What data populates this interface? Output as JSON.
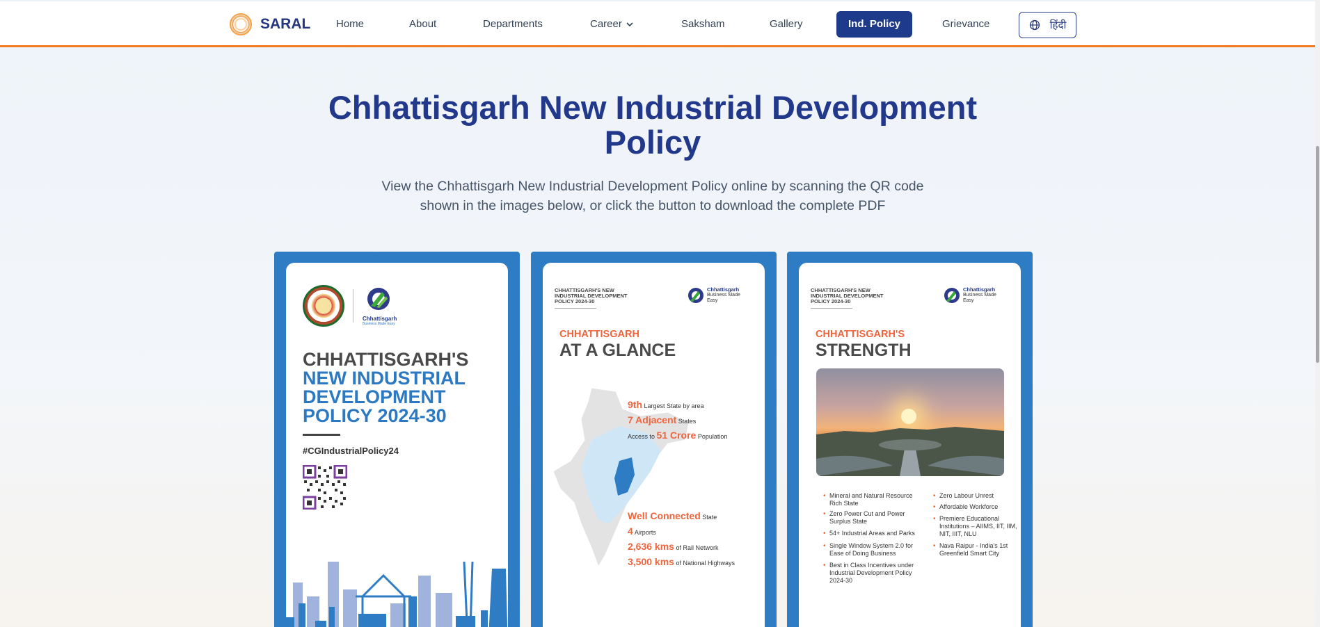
{
  "brand": {
    "name": "SARAL"
  },
  "nav": {
    "home": "Home",
    "about": "About",
    "departments": "Departments",
    "career": "Career",
    "saksham": "Saksham",
    "gallery": "Gallery",
    "ind_policy": "Ind. Policy",
    "grievance": "Grievance",
    "language": "हिंदी"
  },
  "hero": {
    "title": "Chhattisgarh New Industrial Development Policy",
    "subtitle": "View the Chhattisgarh New Industrial Development Policy online by scanning the QR code shown in the images below, or click the button to download the complete PDF"
  },
  "cards": {
    "c1": {
      "logo_text": "Chhattisgarh",
      "logo_sub": "Business Made Easy",
      "line1": "CHHATTISGARH'S",
      "line2": "NEW INDUSTRIAL",
      "line3": "DEVELOPMENT",
      "line4": "POLICY 2024-30",
      "hashtag": "#CGIndustrialPolicy24"
    },
    "header": {
      "policy_label": "CHHATTISGARH'S NEW INDUSTRIAL DEVELOPMENT POLICY 2024-30",
      "logo_text": "Chhattisgarh",
      "logo_sub": "Business Made Easy"
    },
    "c2": {
      "kicker": "CHHATTISGARH",
      "big": "AT A GLANCE",
      "s1_hl": "9th",
      "s1": "Largest State by area",
      "s2_hl": "7 Adjacent",
      "s2": "States",
      "s3_pre": "Access to",
      "s3_hl": "51 Crore",
      "s3": "Population",
      "s4_hl": "Well Connected",
      "s4": "State",
      "s5_hl": "4",
      "s5": "Airports",
      "s6_hl": "2,636 kms",
      "s6": "of Rail Network",
      "s7_hl": "3,500 kms",
      "s7": "of National Highways"
    },
    "c3": {
      "kicker": "CHHATTISGARH'S",
      "big": "STRENGTH",
      "left": [
        "Mineral and Natural Resource Rich State",
        "Zero Power Cut and Power Surplus State",
        "54+ Industrial Areas and Parks",
        "Single Window System 2.0 for Ease of Doing Business",
        "Best in Class Incentives under Industrial Development Policy 2024-30"
      ],
      "right": [
        "Zero Labour Unrest",
        "Affordable Workforce",
        "Premiere Educational Institutions – AIIMS, IIT, IIM, NIT, IIIT, NLU",
        "Nava Raipur - India's 1st Greenfield Smart City"
      ]
    }
  },
  "colors": {
    "accent": "#1e3a8a",
    "orange": "#f07b22",
    "card_blue": "#2e7cc3"
  }
}
